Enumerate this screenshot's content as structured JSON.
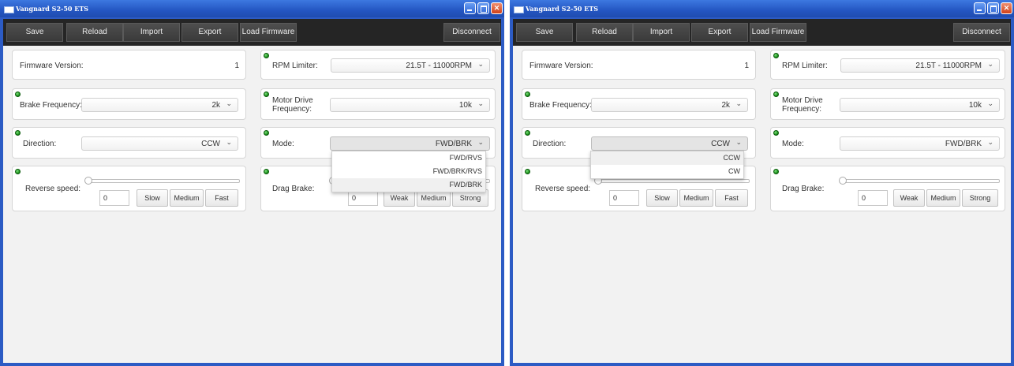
{
  "window_title": "Vangnard S2-50 ETS",
  "toolbar": {
    "save": "Save",
    "reload": "Reload",
    "import": "Import",
    "export": "Export",
    "load_firmware": "Load Firmware",
    "disconnect": "Disconnect"
  },
  "firmware": {
    "label": "Firmware Version:",
    "value": "1"
  },
  "rpm_limiter": {
    "label": "RPM Limiter:",
    "value": "21.5T - 11000RPM"
  },
  "brake_frequency": {
    "label": "Brake Frequency:",
    "value": "2k"
  },
  "motor_drive_frequency": {
    "label_line1": "Motor Drive",
    "label_line2": "Frequency:",
    "value": "10k"
  },
  "direction": {
    "label": "Direction:",
    "value": "CCW",
    "options": [
      "CCW",
      "CW"
    ]
  },
  "mode": {
    "label": "Mode:",
    "value": "FWD/BRK",
    "options": [
      "FWD/RVS",
      "FWD/BRK/RVS",
      "FWD/BRK"
    ]
  },
  "reverse_speed": {
    "label": "Reverse speed:",
    "value": "0",
    "level": 0,
    "presets": [
      "Slow",
      "Medium",
      "Fast"
    ]
  },
  "drag_brake": {
    "label": "Drag Brake:",
    "value": "0",
    "level": 0,
    "presets": [
      "Weak",
      "Medium",
      "Strong"
    ]
  },
  "colors": {
    "title_bar": "#2456c2",
    "toolbar": "#252525",
    "led": "#138a13",
    "client": "#f2f2f2"
  }
}
